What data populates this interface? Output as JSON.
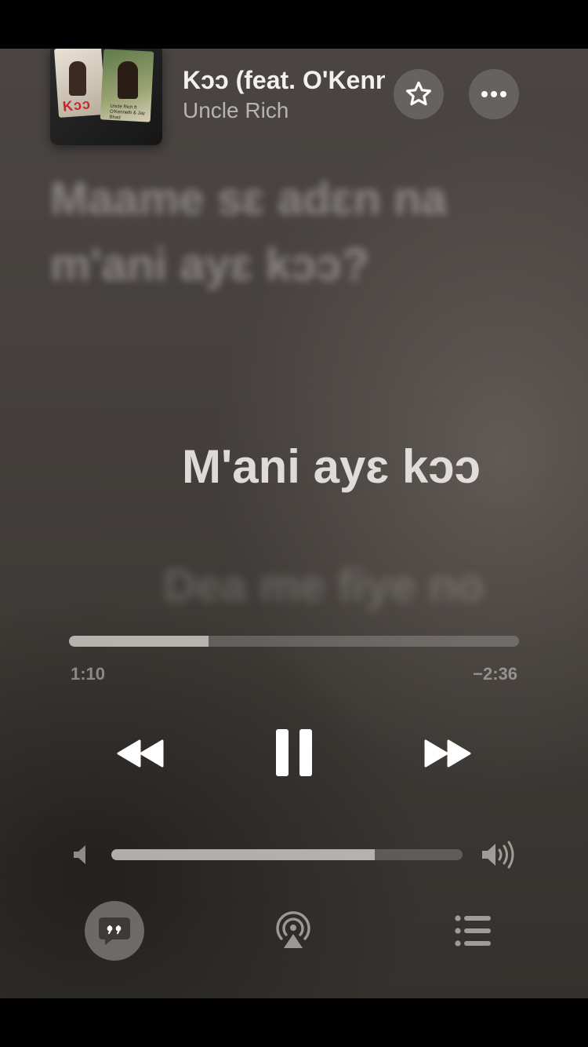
{
  "now_playing": {
    "title": "Kɔɔ (feat. O'Kenneth & Jay Bhad)",
    "artist": "Uncle Rich",
    "artwork": {
      "title_text": "Kɔɔ",
      "credit_text": "Uncle Rich ft O'Kenneth & Jay Bhad"
    }
  },
  "lyrics": {
    "previous": "Maame sɛ adɛn na m'ani ayɛ kɔɔ?",
    "current": "M'ani ayɛ kɔɔ",
    "next": "Dea me fiye no"
  },
  "playback": {
    "elapsed": "1:10",
    "remaining": "−2:36",
    "progress_fraction": 0.31
  },
  "volume": {
    "level_fraction": 0.75
  },
  "icons": {
    "favorite": "star-icon",
    "more": "ellipsis-icon",
    "rewind": "rewind-icon",
    "pause": "pause-icon",
    "forward": "fast-forward-icon",
    "volume_low": "speaker-low-icon",
    "volume_high": "speaker-high-icon",
    "lyrics": "lyrics-quote-icon",
    "airplay": "airplay-icon",
    "queue": "queue-list-icon"
  }
}
